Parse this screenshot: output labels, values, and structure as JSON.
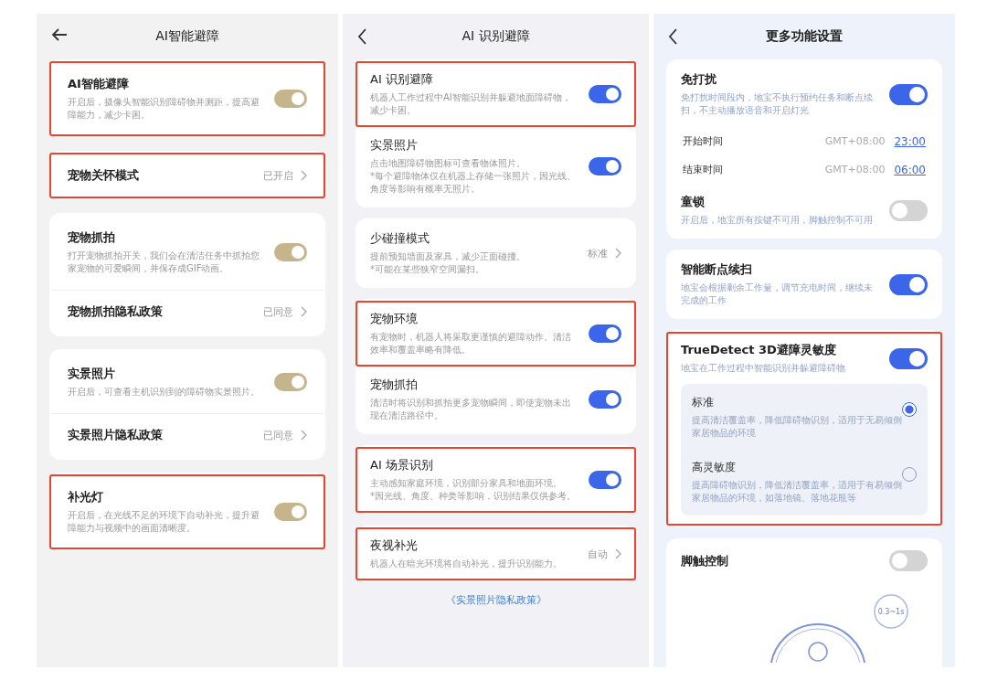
{
  "panels": [
    {
      "title": "AI智能避障",
      "back_button": {
        "kind": "arrow"
      },
      "cards": [
        {
          "items": [
            {
              "kind": "toggle",
              "title": "AI智能避障",
              "description": "开启后，摄像头智能识别障碍物并测距，提高避障能力，减少卡困。",
              "on": true,
              "highlighted": true
            }
          ]
        },
        {
          "items": [
            {
              "kind": "link",
              "title": "宠物关怀模式",
              "value": "已开启",
              "highlighted": true
            }
          ]
        },
        {
          "items": [
            {
              "kind": "toggle",
              "title": "宠物抓拍",
              "description": "打开宠物抓拍开关，我们会在清洁任务中抓拍您家宠物的可爱瞬间，并保存成GIF动画。",
              "on": true,
              "highlighted": false
            },
            {
              "kind": "link",
              "title": "宠物抓拍隐私政策",
              "value": "已同意",
              "highlighted": false
            }
          ]
        },
        {
          "items": [
            {
              "kind": "toggle",
              "title": "实景照片",
              "description": "开启后，可查看主机识别到的障碍物实景照片。",
              "on": true,
              "highlighted": false
            },
            {
              "kind": "link",
              "title": "实景照片隐私政策",
              "value": "已同意",
              "highlighted": false
            }
          ]
        },
        {
          "items": [
            {
              "kind": "toggle",
              "title": "补光灯",
              "description": "开启后，在光线不足的环境下自动补光，提升避障能力与视频中的画面清晰度。",
              "on": true,
              "highlighted": true
            }
          ]
        }
      ]
    },
    {
      "title": "AI 识别避障",
      "back_button": {
        "kind": "chevron"
      },
      "footer_link": "《实景照片隐私政策》",
      "cards": [
        {
          "items": [
            {
              "kind": "toggle",
              "title": "AI 识别避障",
              "description": "机器人工作过程中AI智能识别并躲避地面障碍物，减少卡困。",
              "on": true,
              "highlighted": true
            },
            {
              "kind": "toggle",
              "title": "实景照片",
              "description": "点击地图障碍物图标可查看物体照片。\n*每个避障物体仅在机器上存储一张照片，因光线、角度等影响有概率无照片。",
              "on": true,
              "highlighted": false
            }
          ]
        },
        {
          "items": [
            {
              "kind": "link",
              "title": "少碰撞模式",
              "description": "提前预知墙面及家具，减少正面碰撞。\n*可能在某些狭窄空间漏扫。",
              "value": "标准",
              "highlighted": false
            }
          ]
        },
        {
          "items": [
            {
              "kind": "toggle",
              "title": "宠物环境",
              "description": "有宠物时，机器人将采取更谨慎的避障动作。清洁效率和覆盖率略有降低。",
              "on": true,
              "highlighted": true
            },
            {
              "kind": "toggle",
              "title": "宠物抓拍",
              "description": "清洁时将识别和抓拍更多宠物瞬间，即使宠物未出现在清洁路径中。",
              "on": true,
              "highlighted": false
            }
          ]
        },
        {
          "items": [
            {
              "kind": "toggle",
              "title": "AI 场景识别",
              "description": "主动感知家庭环境，识别部分家具和地面环境。\n*因光线、角度、种类等影响，识别结果仅供参考。",
              "on": true,
              "highlighted": true
            }
          ]
        },
        {
          "items": [
            {
              "kind": "link",
              "title": "夜视补光",
              "description": "机器人在暗光环境将自动补光，提升识别能力。",
              "value": "自动",
              "highlighted": true
            }
          ]
        }
      ]
    },
    {
      "title": "更多功能设置",
      "back_button": {
        "kind": "chevron"
      },
      "cards": [
        {
          "items": [
            {
              "kind": "toggle",
              "title": "免打扰",
              "description": "免打扰时间段内，地宝不执行预约任务和断点续扫，不主动播放语音和开启灯光",
              "on": true,
              "highlighted": false
            },
            {
              "kind": "time",
              "title": "开始时间",
              "zone": "GMT+08:00",
              "time": "23:00"
            },
            {
              "kind": "time",
              "title": "结束时间",
              "zone": "GMT+08:00",
              "time": "06:00"
            },
            {
              "kind": "toggle",
              "title": "童锁",
              "description": "开启后，地宝所有按键不可用，脚触控制不可用",
              "on": false,
              "highlighted": false
            }
          ]
        },
        {
          "items": [
            {
              "kind": "toggle",
              "title": "智能断点续扫",
              "description": "地宝会根据剩余工作量，调节充电时间，继续未完成的工作",
              "on": true,
              "highlighted": false
            }
          ]
        },
        {
          "items": [
            {
              "kind": "toggle",
              "title": "TrueDetect 3D避障灵敏度",
              "description": "地宝在工作过程中智能识别并躲避障碍物",
              "on": true,
              "highlighted": true,
              "options": [
                {
                  "title": "标准",
                  "description": "提高清洁覆盖率，降低障碍物识别，适用于无易倾倒家居物品的环境",
                  "selected": true
                },
                {
                  "title": "高灵敏度",
                  "description": "提高障碍物识别，降低清洁覆盖率，适用于有易倾倒家居物品的环境，如落地镜、落地花瓶等",
                  "selected": false
                }
              ]
            }
          ]
        },
        {
          "items": [
            {
              "kind": "toggle",
              "title": "脚触控制",
              "on": false,
              "highlighted": false,
              "illustration_label": "0.3~1s"
            }
          ]
        }
      ]
    }
  ]
}
